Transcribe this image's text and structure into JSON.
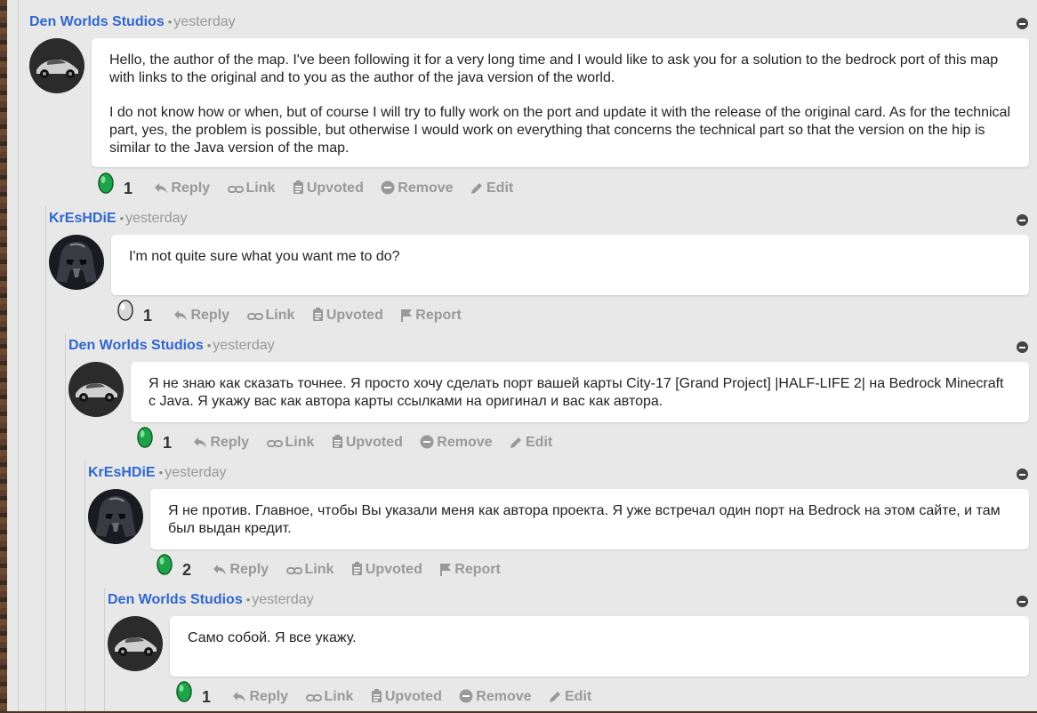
{
  "comments": [
    {
      "author": "Den Worlds Studios",
      "time": "yesterday",
      "avatar": "car-avatar",
      "paragraphs": [
        "Hello, the author of the map. I've been following it for a very long time and I would like to ask you for a solution to the bedrock port of this map with links to the original and to you as the author of the java version of the world.",
        "I do not know how or when, but of course I will try to fully work on the port and update it with the release of the original card. As for the technical part, yes, the problem is possible, but otherwise I would work on everything that concerns the technical part so that the version on the hip is similar to the Java version of the map."
      ],
      "score": "1",
      "gem": "emerald",
      "actions": [
        "Reply",
        "Link",
        "Upvoted",
        "Remove",
        "Edit"
      ]
    },
    {
      "author": "KrEsHDiE",
      "time": "yesterday",
      "avatar": "vader-avatar",
      "paragraphs": [
        "I'm not quite sure what you want me to do?"
      ],
      "score": "1",
      "gem": "silver",
      "actions": [
        "Reply",
        "Link",
        "Upvoted",
        "Report"
      ]
    },
    {
      "author": "Den Worlds Studios",
      "time": "yesterday",
      "avatar": "car-avatar",
      "paragraphs": [
        "Я не знаю как сказать точнее. Я просто хочу сделать порт вашей карты City-17 [Grand Project] |HALF-LIFE 2| на Bedrock Minecraft с Java. Я укажу вас как автора карты ссылками на оригинал и вас как автора."
      ],
      "score": "1",
      "gem": "emerald",
      "actions": [
        "Reply",
        "Link",
        "Upvoted",
        "Remove",
        "Edit"
      ]
    },
    {
      "author": "KrEsHDiE",
      "time": "yesterday",
      "avatar": "vader-avatar",
      "paragraphs": [
        "Я не против. Главное, чтобы Вы указали меня как автора проекта. Я уже встречал один порт на Bedrock на этом сайте, и там был выдан кредит."
      ],
      "score": "2",
      "gem": "emerald",
      "actions": [
        "Reply",
        "Link",
        "Upvoted",
        "Report"
      ]
    },
    {
      "author": "Den Worlds Studios",
      "time": "yesterday",
      "avatar": "car-avatar",
      "paragraphs": [
        "Само собой. Я все укажу."
      ],
      "score": "1",
      "gem": "emerald",
      "actions": [
        "Reply",
        "Link",
        "Upvoted",
        "Remove",
        "Edit"
      ]
    }
  ],
  "separator": "•",
  "colors": {
    "author": "#3167cc",
    "emerald": "#1fa34a",
    "action": "#999999"
  }
}
